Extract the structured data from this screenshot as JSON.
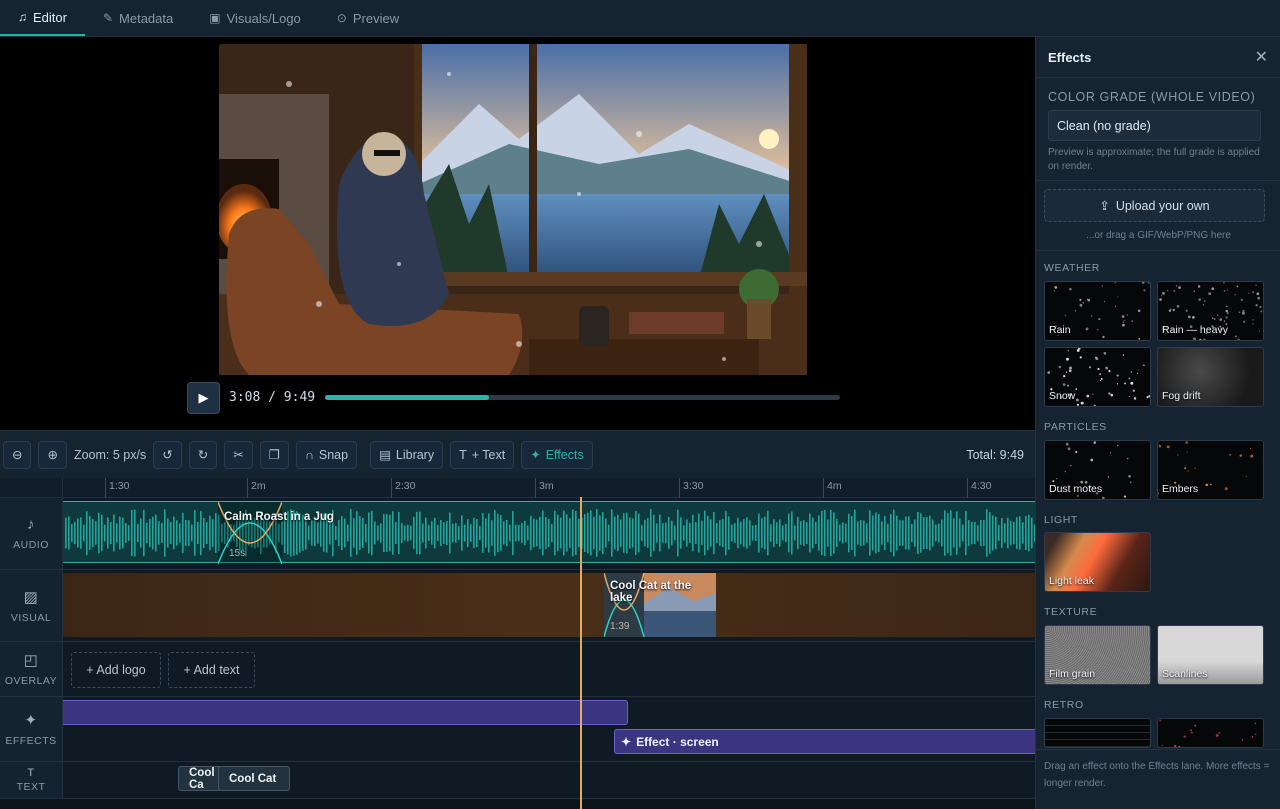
{
  "tabs": [
    {
      "label": "Editor",
      "icon": "music-edit-icon",
      "active": true
    },
    {
      "label": "Metadata",
      "icon": "edit-icon",
      "active": false
    },
    {
      "label": "Visuals/Logo",
      "icon": "image-icon",
      "active": false
    },
    {
      "label": "Preview",
      "icon": "play-circle-icon",
      "active": false
    }
  ],
  "player": {
    "time": "3:08 / 9:49",
    "progress_fraction": 0.319
  },
  "toolbar": {
    "zoom_label": "Zoom: 5 px/s",
    "snap_label": "Snap",
    "library_label": "Library",
    "text_label": "+ Text",
    "effects_label": "Effects",
    "total_label": "Total: 9:49"
  },
  "ruler": [
    "1:30",
    "2m",
    "2:30",
    "3m",
    "3:30",
    "4m",
    "4:30"
  ],
  "lanes": {
    "audio": "AUDIO",
    "visual": "VISUAL",
    "overlay": "OVERLAY",
    "effects": "EFFECTS",
    "text": "TEXT"
  },
  "clips": {
    "audio_title": "Calm Roast in a Jug",
    "audio_fade": "15s",
    "visual_title": "Cool Cat at the lake",
    "visual_fade": "1:39",
    "add_logo": "+ Add logo",
    "add_text": "+ Add text",
    "effect_clip": "Effect · screen",
    "text_clip_1": "Cool Ca",
    "text_clip_2": "Cool Cat"
  },
  "panel": {
    "title": "Effects",
    "color_grade_label": "COLOR GRADE (WHOLE VIDEO)",
    "color_grade_value": "Clean (no grade)",
    "hint": "Preview is approximate; the full grade is applied on render.",
    "upload_label": "Upload your own",
    "drag_hint": "...or drag a GIF/WebP/PNG here",
    "sections": {
      "weather": "WEATHER",
      "particles": "PARTICLES",
      "light": "LIGHT",
      "texture": "TEXTURE",
      "retro": "RETRO"
    },
    "tiles": {
      "rain": "Rain",
      "rain_heavy": "Rain — heavy",
      "snow": "Snow",
      "fog": "Fog drift",
      "dust": "Dust motes",
      "embers": "Embers",
      "light_leak": "Light leak",
      "film_grain": "Film grain",
      "scanlines": "Scanlines"
    },
    "footer": "Drag an effect onto the Effects lane. More effects = longer render."
  },
  "colors": {
    "accent": "#2bb3a8",
    "playhead": "#e9a862",
    "effect": "#3b3580"
  }
}
